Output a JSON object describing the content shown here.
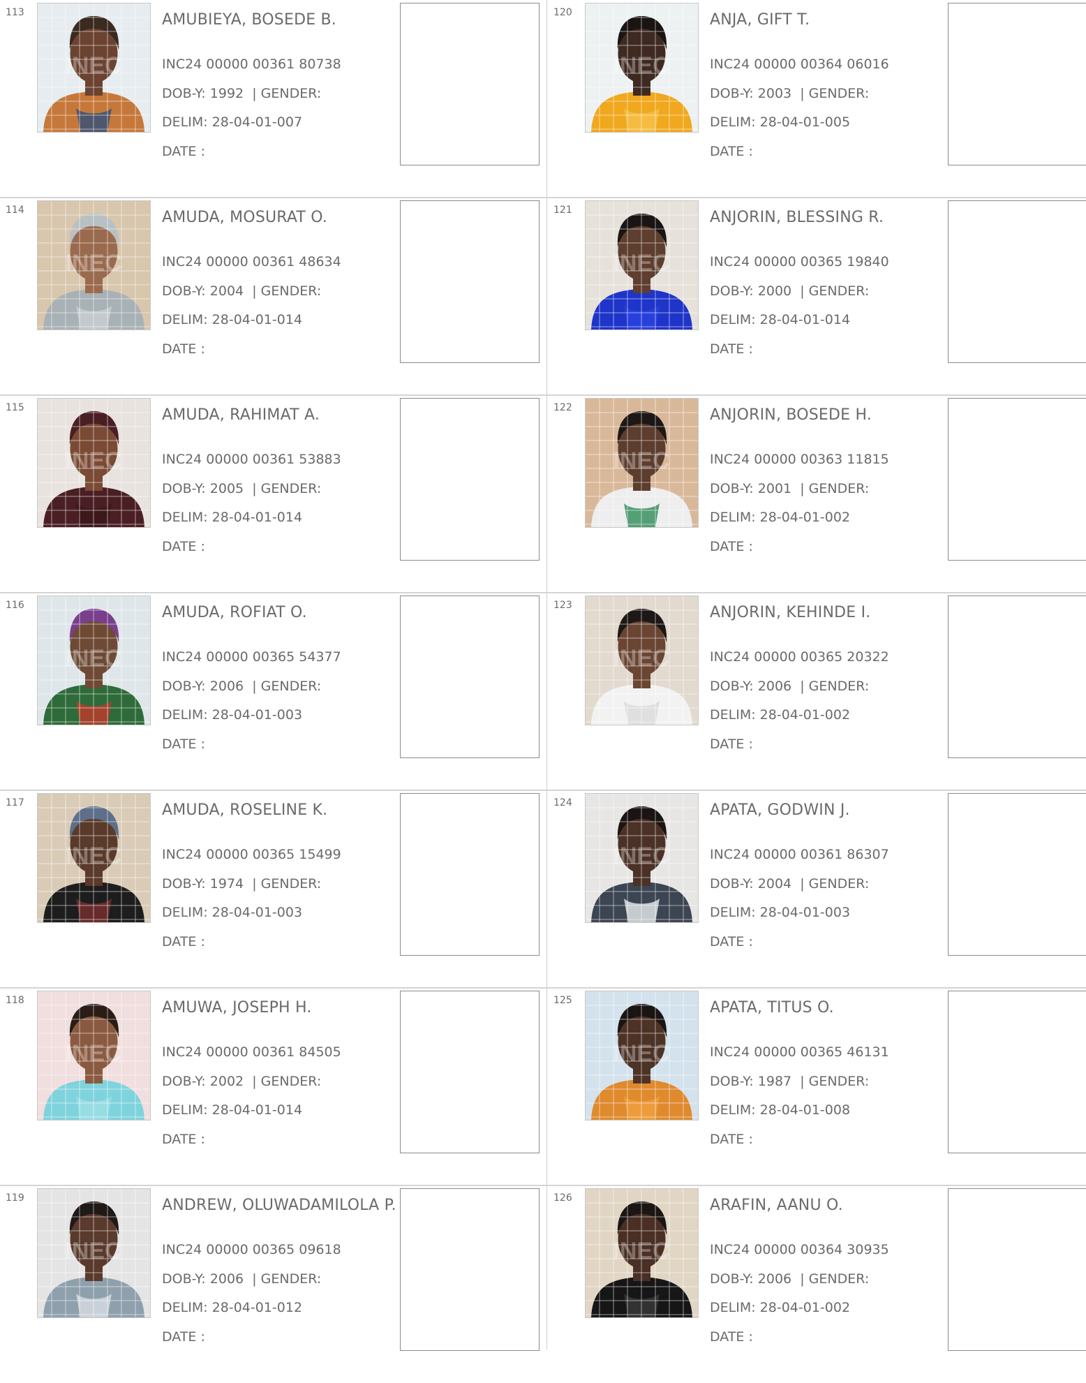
{
  "labels": {
    "dob": "DOB-Y:",
    "gender": "| GENDER:",
    "delim": "DELIM:",
    "date": "DATE  :"
  },
  "photo_watermark": "INEC",
  "entries": [
    {
      "sn": "113",
      "name": "AMUBIEYA, BOSEDE B.",
      "vin": "INC24 00000 00361 80738",
      "dob_year": "1992",
      "delim": "28-04-01-007",
      "photo": {
        "bg": "#e6ecef",
        "skin": "#6b4330",
        "hair": "#3a2a20",
        "cloth": "#c6783a",
        "accent": "#2f4f78"
      }
    },
    {
      "sn": "114",
      "name": "AMUDA, MOSURAT O.",
      "vin": "INC24 00000 00361 48634",
      "dob_year": "2004",
      "delim": "28-04-01-014",
      "photo": {
        "bg": "#d8c6ad",
        "skin": "#9a6a4e",
        "hair": "#b9c0c4",
        "cloth": "#a8b1b6",
        "accent": "#c9cfd2"
      }
    },
    {
      "sn": "115",
      "name": "AMUDA, RAHIMAT A.",
      "vin": "INC24 00000 00361 53883",
      "dob_year": "2005",
      "delim": "28-04-01-014",
      "photo": {
        "bg": "#e9e3df",
        "skin": "#7a4a34",
        "hair": "#4a1f24",
        "cloth": "#4a1f24",
        "accent": "#3a1619"
      }
    },
    {
      "sn": "116",
      "name": "AMUDA, ROFIAT O.",
      "vin": "INC24 00000 00365 54377",
      "dob_year": "2006",
      "delim": "28-04-01-003",
      "photo": {
        "bg": "#dfe6e9",
        "skin": "#6e4a35",
        "hair": "#7a3f8c",
        "cloth": "#2f6b3a",
        "accent": "#c0392b"
      }
    },
    {
      "sn": "117",
      "name": "AMUDA, ROSELINE K.",
      "vin": "INC24 00000 00365 15499",
      "dob_year": "1974",
      "delim": "28-04-01-003",
      "photo": {
        "bg": "#d9cbb6",
        "skin": "#5a3a2a",
        "hair": "#5d6f8a",
        "cloth": "#1d1d1d",
        "accent": "#7a2f2f"
      }
    },
    {
      "sn": "118",
      "name": "AMUWA, JOSEPH H.",
      "vin": "INC24 00000 00361 84505",
      "dob_year": "2002",
      "delim": "28-04-01-014",
      "photo": {
        "bg": "#f1dede",
        "skin": "#8a5a40",
        "hair": "#2b1d16",
        "cloth": "#7fd3dc",
        "accent": "#9fe0e6"
      }
    },
    {
      "sn": "119",
      "name": "ANDREW, OLUWADAMILOLA P.",
      "vin": "INC24 00000 00365 09618",
      "dob_year": "2006",
      "delim": "28-04-01-012",
      "photo": {
        "bg": "#e4e4e4",
        "skin": "#5a3a2c",
        "hair": "#1f1a18",
        "cloth": "#8fa0ad",
        "accent": "#d7dde2"
      }
    },
    {
      "sn": "120",
      "name": "ANJA, GIFT T.",
      "vin": "INC24 00000 00364 06016",
      "dob_year": "2003",
      "delim": "28-04-01-005",
      "photo": {
        "bg": "#eef1f2",
        "skin": "#3f2a22",
        "hair": "#1a1412",
        "cloth": "#f0a81e",
        "accent": "#f6c04a"
      }
    },
    {
      "sn": "121",
      "name": "ANJORIN, BLESSING R.",
      "vin": "INC24 00000 00365 19840",
      "dob_year": "2000",
      "delim": "28-04-01-014",
      "photo": {
        "bg": "#e6e1da",
        "skin": "#5e3e2e",
        "hair": "#1a1514",
        "cloth": "#1f34c9",
        "accent": "#2a44e0"
      }
    },
    {
      "sn": "122",
      "name": "ANJORIN, BOSEDE H.",
      "vin": "INC24 00000 00363 11815",
      "dob_year": "2001",
      "delim": "28-04-01-002",
      "photo": {
        "bg": "#d9b89a",
        "skin": "#5c3d2e",
        "hair": "#1d1816",
        "cloth": "#eeeeee",
        "accent": "#2e8b57"
      }
    },
    {
      "sn": "123",
      "name": "ANJORIN, KEHINDE I.",
      "vin": "INC24 00000 00365 20322",
      "dob_year": "2006",
      "delim": "28-04-01-002",
      "photo": {
        "bg": "#e2d9cf",
        "skin": "#6a4532",
        "hair": "#1d1816",
        "cloth": "#f2f2f2",
        "accent": "#d9d9d9"
      }
    },
    {
      "sn": "124",
      "name": "APATA, GODWIN J.",
      "vin": "INC24 00000 00361 86307",
      "dob_year": "2004",
      "delim": "28-04-01-003",
      "photo": {
        "bg": "#e8e6e4",
        "skin": "#4c3126",
        "hair": "#1a1513",
        "cloth": "#3c4552",
        "accent": "#e9ecef"
      }
    },
    {
      "sn": "125",
      "name": "APATA, TITUS O.",
      "vin": "INC24 00000 00365 46131",
      "dob_year": "1987",
      "delim": "28-04-01-008",
      "photo": {
        "bg": "#d3e2ec",
        "skin": "#4d3226",
        "hair": "#1a1513",
        "cloth": "#e08a2e",
        "accent": "#f0a040"
      }
    },
    {
      "sn": "126",
      "name": "ARAFIN, AANU O.",
      "vin": "INC24 00000 00364 30935",
      "dob_year": "2006",
      "delim": "28-04-01-002",
      "photo": {
        "bg": "#e1d6c4",
        "skin": "#4a2f24",
        "hair": "#1b1614",
        "cloth": "#161616",
        "accent": "#3a3a3a"
      }
    }
  ]
}
